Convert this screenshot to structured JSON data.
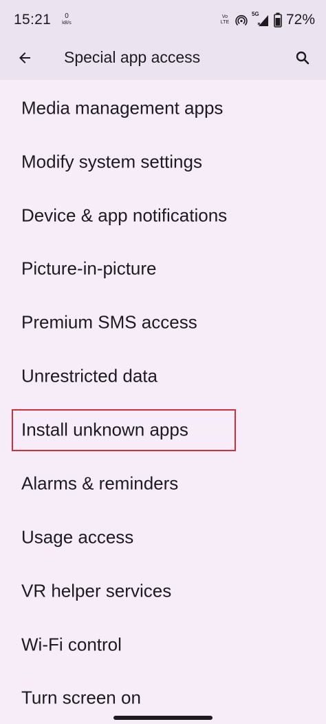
{
  "status_bar": {
    "time": "15:21",
    "net_speed_value": "0",
    "net_speed_unit": "kB/s",
    "volte_top": "Vo",
    "volte_bottom": "LTE",
    "network_type": "5G",
    "battery_percent": "72%"
  },
  "app_bar": {
    "title": "Special app access"
  },
  "list": {
    "items": [
      {
        "label": "Media management apps"
      },
      {
        "label": "Modify system settings"
      },
      {
        "label": "Device & app notifications"
      },
      {
        "label": "Picture-in-picture"
      },
      {
        "label": "Premium SMS access"
      },
      {
        "label": "Unrestricted data"
      },
      {
        "label": "Install unknown apps"
      },
      {
        "label": "Alarms & reminders"
      },
      {
        "label": "Usage access"
      },
      {
        "label": "VR helper services"
      },
      {
        "label": "Wi-Fi control"
      },
      {
        "label": "Turn screen on"
      }
    ]
  },
  "colors": {
    "background": "#f6edf9",
    "app_bar": "#ebe3f0",
    "highlight": "#d32f3b",
    "text": "#1d1b20"
  }
}
